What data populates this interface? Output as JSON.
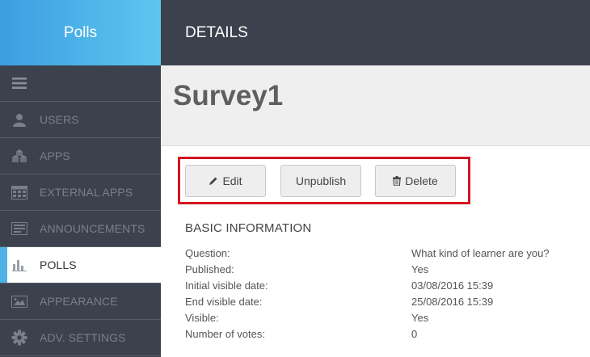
{
  "brand": {
    "title": "Polls"
  },
  "header": {
    "title": "DETAILS"
  },
  "sidebar": {
    "items": [
      {
        "label": "",
        "icon": "menu-icon"
      },
      {
        "label": "USERS",
        "icon": "user-icon"
      },
      {
        "label": "APPS",
        "icon": "apps-icon"
      },
      {
        "label": "EXTERNAL APPS",
        "icon": "external-apps-icon"
      },
      {
        "label": "ANNOUNCEMENTS",
        "icon": "announcements-icon"
      },
      {
        "label": "POLLS",
        "icon": "polls-icon",
        "active": true
      },
      {
        "label": "APPEARANCE",
        "icon": "appearance-icon"
      },
      {
        "label": "ADV. SETTINGS",
        "icon": "gear-icon"
      }
    ]
  },
  "page": {
    "title": "Survey1"
  },
  "actions": {
    "edit_label": "Edit",
    "unpublish_label": "Unpublish",
    "delete_label": "Delete"
  },
  "basic_info": {
    "title": "BASIC INFORMATION",
    "rows": [
      {
        "key": "Question:",
        "value": "What kind of learner are you?"
      },
      {
        "key": "Published:",
        "value": "Yes"
      },
      {
        "key": "Initial visible date:",
        "value": "03/08/2016 15:39"
      },
      {
        "key": "End visible date:",
        "value": "25/08/2016 15:39"
      },
      {
        "key": "Visible:",
        "value": "Yes"
      },
      {
        "key": "Number of votes:",
        "value": "0"
      }
    ]
  },
  "colors": {
    "sidebar_bg": "#3c424d",
    "brand_accent": "#4fb1e6",
    "highlight_border": "#d4141f"
  }
}
